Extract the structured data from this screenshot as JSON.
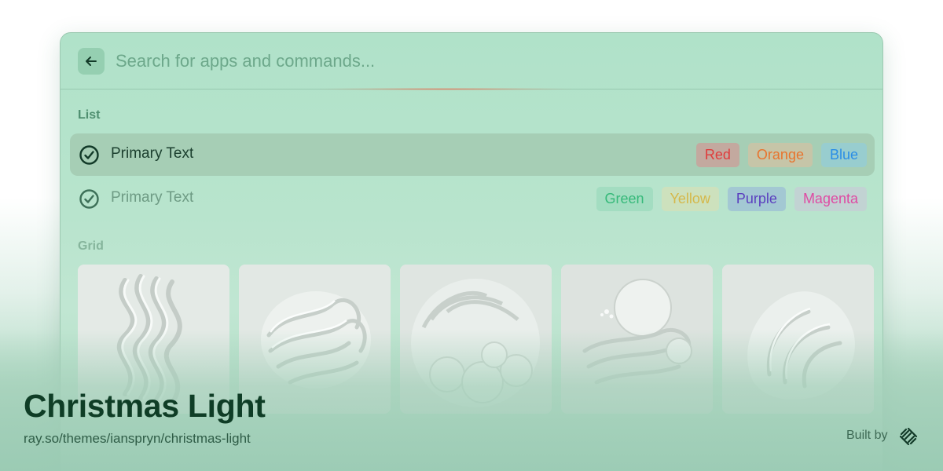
{
  "search": {
    "placeholder": "Search for apps and commands...",
    "value": ""
  },
  "list": {
    "title": "List",
    "items": [
      {
        "label": "Primary Text",
        "icon": "check-circle-icon",
        "selected": true,
        "tags": [
          {
            "label": "Red",
            "color": "#e03c3c",
            "bg": "#c3a99f"
          },
          {
            "label": "Orange",
            "color": "#e8742e",
            "bg": "#c6c5a8"
          },
          {
            "label": "Blue",
            "color": "#2a8ee6",
            "bg": "#98cdcf"
          }
        ]
      },
      {
        "label": "Primary Text",
        "icon": "check-circle-icon",
        "selected": false,
        "tags": [
          {
            "label": "Green",
            "color": "#36b97a",
            "bg": "#a3ddc1"
          },
          {
            "label": "Yellow",
            "color": "#d5b84a",
            "bg": "#cde1bd"
          },
          {
            "label": "Purple",
            "color": "#5b3fbf",
            "bg": "#a3c8d3"
          },
          {
            "label": "Magenta",
            "color": "#df4aa3",
            "bg": "#c2d3d3"
          }
        ]
      }
    ]
  },
  "grid": {
    "title": "Grid",
    "items": [
      {
        "name": "wave-sculpture-1"
      },
      {
        "name": "wave-sculpture-2"
      },
      {
        "name": "wave-sculpture-3"
      },
      {
        "name": "wave-sculpture-4"
      },
      {
        "name": "wave-sculpture-5"
      }
    ]
  },
  "footer": {
    "theme_name": "Christmas Light",
    "url": "ray.so/themes/ianspryn/christmas-light",
    "built_by": "Built by",
    "logo": "raycast-logo"
  },
  "colors": {
    "accent": "#0f3d26",
    "window_bg": "#b8e4cd",
    "selection": "#a6ceb5"
  }
}
